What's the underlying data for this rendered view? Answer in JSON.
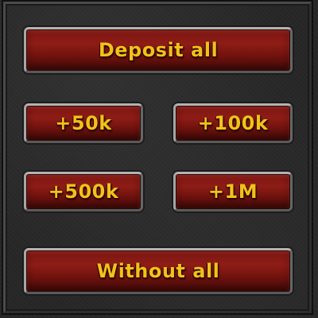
{
  "buttons": {
    "deposit_all": "Deposit all",
    "plus_50k": "+50k",
    "plus_100k": "+100k",
    "plus_500k": "+500k",
    "plus_1m": "+1M",
    "without_all": "Without all"
  },
  "colors": {
    "button_fill": "#8e1c16",
    "button_text": "#f0c21a",
    "button_border": "#8b8b8b",
    "panel_background": "#262626"
  }
}
